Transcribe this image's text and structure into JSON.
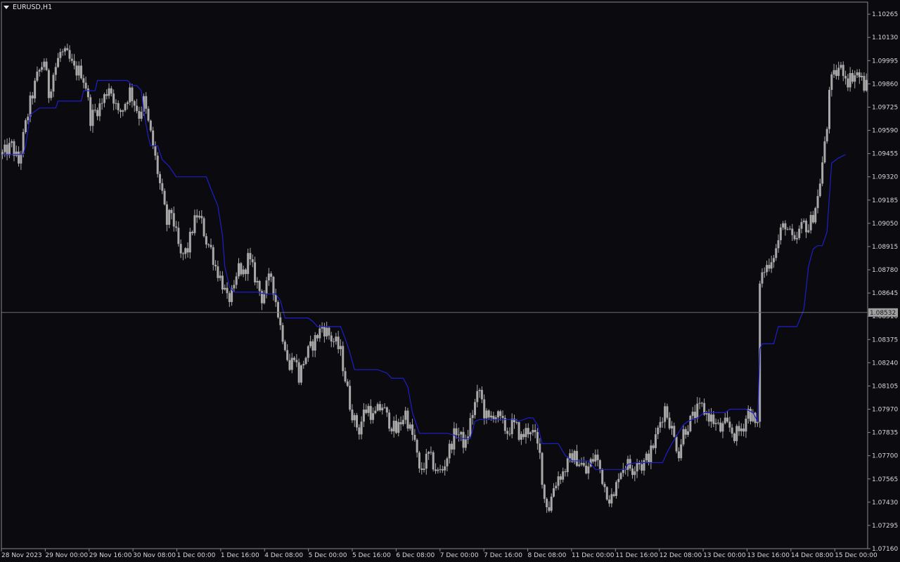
{
  "symbol_label": "EURUSD,H1",
  "colors": {
    "background": "#0b0b0f",
    "candle_color": "#a8a8a8",
    "indicator_color": "#1e1ec8",
    "frame_color": "#8a8a8a",
    "price_line_color": "#6e6e6e",
    "text_color": "#d8d8d8",
    "price_tag_bg": "#a0a0a0"
  },
  "current_price": "1.08532",
  "chart_data": {
    "type": "candlestick",
    "title": "EURUSD,H1",
    "ylim": [
      1.0716,
      1.10335
    ],
    "y_ticks": [
      "1.10265",
      "1.10130",
      "1.09995",
      "1.09860",
      "1.09725",
      "1.09590",
      "1.09455",
      "1.09320",
      "1.09185",
      "1.09050",
      "1.08915",
      "1.08780",
      "1.08645",
      "1.08510",
      "1.08375",
      "1.08240",
      "1.08105",
      "1.07970",
      "1.07835",
      "1.07700",
      "1.07565",
      "1.07430",
      "1.07295",
      "1.07160"
    ],
    "x_ticks": [
      "28 Nov 2023",
      "29 Nov 00:00",
      "29 Nov 16:00",
      "30 Nov 08:00",
      "1 Dec 00:00",
      "1 Dec 16:00",
      "4 Dec 08:00",
      "5 Dec 00:00",
      "5 Dec 16:00",
      "6 Dec 08:00",
      "7 Dec 00:00",
      "7 Dec 16:00",
      "8 Dec 08:00",
      "11 Dec 00:00",
      "11 Dec 16:00",
      "12 Dec 08:00",
      "13 Dec 00:00",
      "13 Dec 16:00",
      "14 Dec 08:00",
      "15 Dec 00:00"
    ],
    "price_path": [
      [
        0,
        1.0945
      ],
      [
        4,
        1.095
      ],
      [
        7,
        1.094
      ],
      [
        10,
        1.0962
      ],
      [
        12,
        1.0975
      ],
      [
        15,
        1.099
      ],
      [
        18,
        1.1
      ],
      [
        20,
        1.098
      ],
      [
        22,
        1.0992
      ],
      [
        25,
        1.1004
      ],
      [
        28,
        1.1002
      ],
      [
        31,
        1.0994
      ],
      [
        34,
        1.0993
      ],
      [
        36,
        1.0985
      ],
      [
        38,
        1.0966
      ],
      [
        40,
        1.097
      ],
      [
        43,
        1.0975
      ],
      [
        46,
        1.0985
      ],
      [
        48,
        1.0978
      ],
      [
        50,
        1.0968
      ],
      [
        52,
        1.0972
      ],
      [
        55,
        1.0982
      ],
      [
        57,
        1.0975
      ],
      [
        59,
        1.0968
      ],
      [
        61,
        1.0976
      ],
      [
        63,
        1.0963
      ],
      [
        65,
        1.095
      ],
      [
        67,
        1.0935
      ],
      [
        69,
        1.092
      ],
      [
        71,
        1.0905
      ],
      [
        73,
        1.0912
      ],
      [
        75,
        1.0898
      ],
      [
        77,
        1.0885
      ],
      [
        80,
        1.089
      ],
      [
        82,
        1.0902
      ],
      [
        84,
        1.091
      ],
      [
        86,
        1.0905
      ],
      [
        88,
        1.0895
      ],
      [
        90,
        1.089
      ],
      [
        92,
        1.088
      ],
      [
        95,
        1.087
      ],
      [
        97,
        1.086
      ],
      [
        100,
        1.0865
      ],
      [
        102,
        1.088
      ],
      [
        104,
        1.0875
      ],
      [
        106,
        1.0885
      ],
      [
        108,
        1.0878
      ],
      [
        110,
        1.087
      ],
      [
        112,
        1.0862
      ],
      [
        114,
        1.0868
      ],
      [
        116,
        1.0875
      ],
      [
        118,
        1.086
      ],
      [
        120,
        1.0845
      ],
      [
        122,
        1.0835
      ],
      [
        124,
        1.082
      ],
      [
        126,
        1.083
      ],
      [
        128,
        1.0815
      ],
      [
        130,
        1.0825
      ],
      [
        132,
        1.083
      ],
      [
        134,
        1.0835
      ],
      [
        136,
        1.084
      ],
      [
        138,
        1.0845
      ],
      [
        140,
        1.0842
      ],
      [
        142,
        1.0838
      ],
      [
        144,
        1.0835
      ],
      [
        146,
        1.083
      ],
      [
        148,
        1.0815
      ],
      [
        150,
        1.08
      ],
      [
        152,
        1.079
      ],
      [
        154,
        1.0785
      ],
      [
        156,
        1.0795
      ],
      [
        158,
        1.0798
      ],
      [
        160,
        1.0792
      ],
      [
        162,
        1.0796
      ],
      [
        164,
        1.0799
      ],
      [
        166,
        1.0792
      ],
      [
        168,
        1.0788
      ],
      [
        170,
        1.0784
      ],
      [
        172,
        1.079
      ],
      [
        174,
        1.0795
      ],
      [
        176,
        1.0785
      ],
      [
        178,
        1.0778
      ],
      [
        180,
        1.076
      ],
      [
        182,
        1.0765
      ],
      [
        184,
        1.077
      ],
      [
        186,
        1.0765
      ],
      [
        188,
        1.076
      ],
      [
        190,
        1.0762
      ],
      [
        192,
        1.077
      ],
      [
        194,
        1.0778
      ],
      [
        196,
        1.0785
      ],
      [
        198,
        1.078
      ],
      [
        200,
        1.0776
      ],
      [
        202,
        1.079
      ],
      [
        204,
        1.08
      ],
      [
        206,
        1.0808
      ],
      [
        208,
        1.0795
      ],
      [
        210,
        1.079
      ],
      [
        212,
        1.0795
      ],
      [
        214,
        1.0792
      ],
      [
        216,
        1.0788
      ],
      [
        218,
        1.0784
      ],
      [
        220,
        1.0788
      ],
      [
        222,
        1.0786
      ],
      [
        224,
        1.078
      ],
      [
        226,
        1.0784
      ],
      [
        228,
        1.0786
      ],
      [
        230,
        1.078
      ],
      [
        232,
        1.077
      ],
      [
        234,
        1.0745
      ],
      [
        236,
        1.074
      ],
      [
        238,
        1.0752
      ],
      [
        240,
        1.0758
      ],
      [
        242,
        1.076
      ],
      [
        244,
        1.0765
      ],
      [
        246,
        1.077
      ],
      [
        248,
        1.0768
      ],
      [
        250,
        1.0765
      ],
      [
        252,
        1.076
      ],
      [
        254,
        1.0766
      ],
      [
        256,
        1.077
      ],
      [
        258,
        1.0762
      ],
      [
        260,
        1.0752
      ],
      [
        262,
        1.0746
      ],
      [
        264,
        1.0745
      ],
      [
        266,
        1.076
      ],
      [
        268,
        1.0764
      ],
      [
        270,
        1.0765
      ],
      [
        272,
        1.0762
      ],
      [
        274,
        1.0768
      ],
      [
        276,
        1.0764
      ],
      [
        278,
        1.0768
      ],
      [
        280,
        1.0772
      ],
      [
        282,
        1.078
      ],
      [
        284,
        1.079
      ],
      [
        286,
        1.0798
      ],
      [
        288,
        1.079
      ],
      [
        290,
        1.078
      ],
      [
        292,
        1.0772
      ],
      [
        294,
        1.0784
      ],
      [
        296,
        1.0788
      ],
      [
        298,
        1.0792
      ],
      [
        300,
        1.0796
      ],
      [
        302,
        1.0798
      ],
      [
        304,
        1.0794
      ],
      [
        306,
        1.0792
      ],
      [
        308,
        1.0788
      ],
      [
        310,
        1.0785
      ],
      [
        312,
        1.0788
      ],
      [
        314,
        1.0786
      ],
      [
        316,
        1.0782
      ],
      [
        318,
        1.0784
      ],
      [
        320,
        1.0788
      ],
      [
        322,
        1.0796
      ],
      [
        324,
        1.0792
      ],
      [
        325,
        1.0788
      ],
      [
        326,
        1.0786
      ],
      [
        327,
        1.0832
      ],
      [
        328,
        1.0875
      ],
      [
        330,
        1.088
      ],
      [
        332,
        1.0885
      ],
      [
        334,
        1.089
      ],
      [
        336,
        1.09
      ],
      [
        338,
        1.0905
      ],
      [
        340,
        1.0898
      ],
      [
        342,
        1.0892
      ],
      [
        344,
        1.09
      ],
      [
        346,
        1.0905
      ],
      [
        348,
        1.0902
      ],
      [
        350,
        1.091
      ],
      [
        352,
        1.092
      ],
      [
        354,
        1.094
      ],
      [
        356,
        1.096
      ],
      [
        357,
        1.0985
      ],
      [
        359,
        1.099
      ],
      [
        361,
        1.0995
      ],
      [
        363,
        1.0994
      ],
      [
        365,
        1.0988
      ],
      [
        367,
        1.0991
      ],
      [
        369,
        1.0992
      ],
      [
        371,
        1.0988
      ],
      [
        372,
        1.0985
      ]
    ],
    "indicator_path": [
      [
        0,
        1.0945
      ],
      [
        9,
        1.0945
      ],
      [
        10,
        1.095
      ],
      [
        12,
        1.0968
      ],
      [
        16,
        1.0972
      ],
      [
        23,
        1.0972
      ],
      [
        24,
        1.0976
      ],
      [
        34,
        1.0976
      ],
      [
        35,
        1.0982
      ],
      [
        40,
        1.0982
      ],
      [
        41,
        1.0988
      ],
      [
        54,
        1.0988
      ],
      [
        56,
        1.0985
      ],
      [
        58,
        1.0985
      ],
      [
        60,
        1.0982
      ],
      [
        61,
        1.097
      ],
      [
        63,
        1.0955
      ],
      [
        64,
        1.095
      ],
      [
        67,
        1.095
      ],
      [
        69,
        1.0942
      ],
      [
        72,
        1.0938
      ],
      [
        75,
        1.0932
      ],
      [
        88,
        1.0932
      ],
      [
        90,
        1.0925
      ],
      [
        93,
        1.0915
      ],
      [
        95,
        1.0898
      ],
      [
        96,
        1.088
      ],
      [
        98,
        1.0868
      ],
      [
        100,
        1.0865
      ],
      [
        110,
        1.0865
      ],
      [
        113,
        1.0864
      ],
      [
        118,
        1.0864
      ],
      [
        120,
        1.086
      ],
      [
        122,
        1.085
      ],
      [
        132,
        1.085
      ],
      [
        134,
        1.0848
      ],
      [
        136,
        1.0845
      ],
      [
        146,
        1.0845
      ],
      [
        148,
        1.0838
      ],
      [
        150,
        1.083
      ],
      [
        152,
        1.082
      ],
      [
        156,
        1.082
      ],
      [
        162,
        1.082
      ],
      [
        166,
        1.0818
      ],
      [
        168,
        1.0815
      ],
      [
        173,
        1.0815
      ],
      [
        175,
        1.081
      ],
      [
        177,
        1.0795
      ],
      [
        179,
        1.0787
      ],
      [
        180,
        1.0783
      ],
      [
        192,
        1.0783
      ],
      [
        195,
        1.0782
      ],
      [
        197,
        1.078
      ],
      [
        202,
        1.078
      ],
      [
        204,
        1.079
      ],
      [
        206,
        1.0791
      ],
      [
        221,
        1.0791
      ],
      [
        223,
        1.079
      ],
      [
        227,
        1.0792
      ],
      [
        229,
        1.0792
      ],
      [
        231,
        1.0788
      ],
      [
        233,
        1.0777
      ],
      [
        240,
        1.0777
      ],
      [
        243,
        1.077
      ],
      [
        246,
        1.0767
      ],
      [
        253,
        1.0767
      ],
      [
        256,
        1.0762
      ],
      [
        265,
        1.0762
      ],
      [
        269,
        1.0762
      ],
      [
        270,
        1.0765
      ],
      [
        274,
        1.0766
      ],
      [
        285,
        1.0766
      ],
      [
        287,
        1.0772
      ],
      [
        289,
        1.0777
      ],
      [
        294,
        1.0788
      ],
      [
        296,
        1.079
      ],
      [
        300,
        1.0792
      ],
      [
        303,
        1.0795
      ],
      [
        312,
        1.0795
      ],
      [
        314,
        1.0797
      ],
      [
        321,
        1.0797
      ],
      [
        324,
        1.0795
      ],
      [
        326,
        1.079
      ],
      [
        327,
        1.0832
      ],
      [
        328,
        1.0835
      ],
      [
        333,
        1.0835
      ],
      [
        335,
        1.0845
      ],
      [
        343,
        1.0845
      ],
      [
        346,
        1.0855
      ],
      [
        348,
        1.088
      ],
      [
        350,
        1.089
      ],
      [
        352,
        1.0892
      ],
      [
        354,
        1.0892
      ],
      [
        356,
        1.09
      ],
      [
        358,
        1.094
      ],
      [
        361,
        1.0943
      ],
      [
        364,
        1.0945
      ]
    ],
    "indicator_name": ""
  }
}
